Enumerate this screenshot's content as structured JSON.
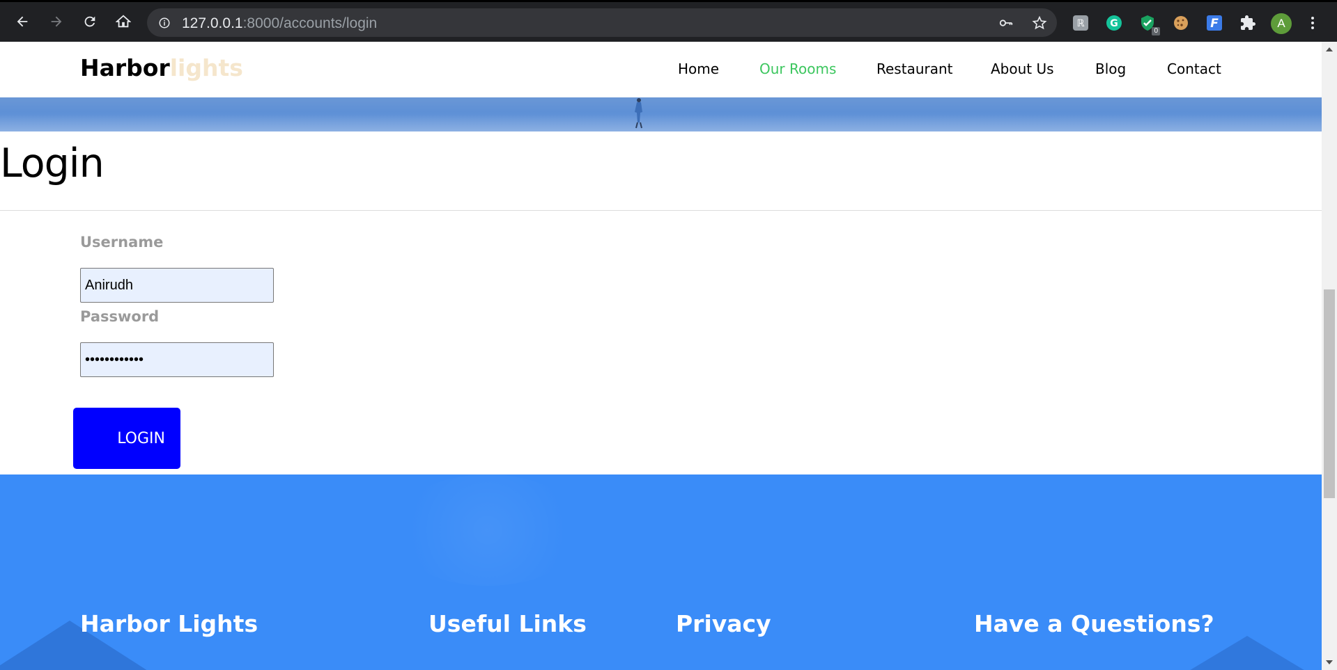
{
  "browser": {
    "url_host": "127.0.0.1",
    "url_path": ":8000/accounts/login",
    "extensions": [
      "grammarly-icon",
      "shield-check-icon",
      "cookie-icon",
      "f-icon",
      "puzzle-icon"
    ],
    "ext_badge_count": "0",
    "profile_initial": "A"
  },
  "site": {
    "brand_main": "Harbor",
    "brand_accent": "lights",
    "menu": [
      {
        "label": "Home",
        "active": false
      },
      {
        "label": "Our Rooms",
        "active": true
      },
      {
        "label": "Restaurant",
        "active": false
      },
      {
        "label": "About Us",
        "active": false
      },
      {
        "label": "Blog",
        "active": false
      },
      {
        "label": "Contact",
        "active": false
      }
    ]
  },
  "login": {
    "title": "Login",
    "username_label": "Username",
    "username_value": "Anirudh",
    "password_label": "Password",
    "password_value": "••••••••••••",
    "submit_label": "LOGIN"
  },
  "footer": {
    "headings": [
      "Harbor Lights",
      "Useful Links",
      "Privacy",
      "Have a Questions?"
    ]
  },
  "colors": {
    "active_menu": "#3cc65e",
    "brand_accent": "#f5e6cc",
    "login_button": "#0000ff",
    "footer_bg": "#3a8cf8",
    "input_bg": "#e8f0fe"
  }
}
